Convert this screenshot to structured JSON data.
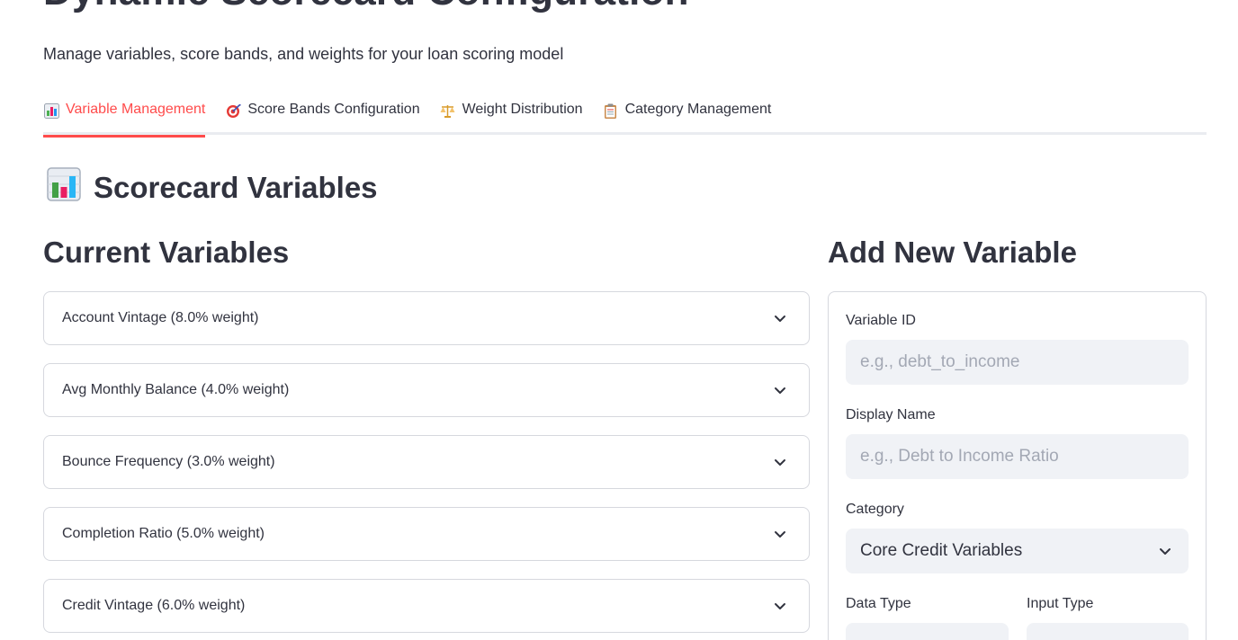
{
  "page": {
    "title": "Dynamic Scorecard Configuration",
    "subtitle": "Manage variables, score bands, and weights for your loan scoring model"
  },
  "tabs": [
    {
      "label": "Variable Management",
      "icon": "bar-chart-icon",
      "active": true
    },
    {
      "label": "Score Bands Configuration",
      "icon": "target-icon",
      "active": false
    },
    {
      "label": "Weight Distribution",
      "icon": "scales-icon",
      "active": false
    },
    {
      "label": "Category Management",
      "icon": "clipboard-icon",
      "active": false
    }
  ],
  "section": {
    "title": "Scorecard Variables",
    "icon": "bar-chart-icon"
  },
  "current_variables": {
    "title": "Current Variables",
    "items": [
      {
        "label": "Account Vintage (8.0% weight)"
      },
      {
        "label": "Avg Monthly Balance (4.0% weight)"
      },
      {
        "label": "Bounce Frequency (3.0% weight)"
      },
      {
        "label": "Completion Ratio (5.0% weight)"
      },
      {
        "label": "Credit Vintage (6.0% weight)"
      }
    ]
  },
  "add_variable": {
    "title": "Add New Variable",
    "variable_id": {
      "label": "Variable ID",
      "placeholder": "e.g., debt_to_income",
      "value": ""
    },
    "display_name": {
      "label": "Display Name",
      "placeholder": "e.g., Debt to Income Ratio",
      "value": ""
    },
    "category": {
      "label": "Category",
      "value": "Core Credit Variables"
    },
    "data_type": {
      "label": "Data Type"
    },
    "input_type": {
      "label": "Input Type"
    }
  },
  "colors": {
    "accent": "#ff4b4b",
    "text": "#31333f",
    "input_bg": "#f0f2f6",
    "border": "#d6d8de"
  }
}
